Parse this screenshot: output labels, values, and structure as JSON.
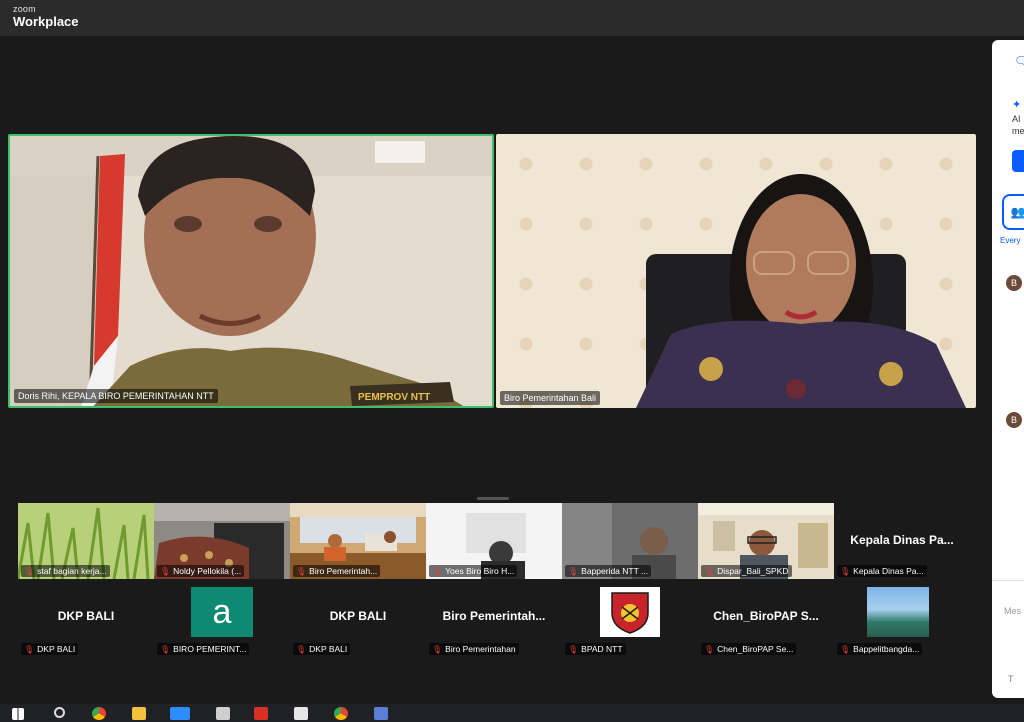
{
  "app": {
    "brand_small": "zoom",
    "brand_big": "Workplace"
  },
  "speakers": [
    {
      "name": "Doris Rihi, KEPALA BIRO PEMERINTAHAN NTT",
      "shirt_text": "PEMPROV NTT"
    },
    {
      "name": "Biro Pemerintahan Bali"
    }
  ],
  "thumbs_row1": [
    {
      "avatar_name": "",
      "tag": "staf bagian kerja..."
    },
    {
      "avatar_name": "",
      "tag": "Noldy Pellokila (..."
    },
    {
      "avatar_name": "",
      "tag": "Biro Pemerintah..."
    },
    {
      "avatar_name": "",
      "tag": "Yoes Biro Biro H..."
    },
    {
      "avatar_name": "",
      "tag": "Bapperida NTT ..."
    },
    {
      "avatar_name": "",
      "tag": "Dispar_Bali_SPKD"
    },
    {
      "avatar_name": "Kepala Dinas Pa...",
      "tag": "Kepala Dinas Pa..."
    }
  ],
  "thumbs_row2": [
    {
      "avatar_name": "DKP BALI",
      "tag": "DKP BALI"
    },
    {
      "avatar_letter": "a",
      "tag": "BIRO PEMERINT..."
    },
    {
      "avatar_name": "DKP BALI",
      "tag": "DKP BALI"
    },
    {
      "avatar_name": "Biro Pemerintah...",
      "tag": "Biro Pemerintahan"
    },
    {
      "avatar_name": "",
      "tag": "BPAD NTT"
    },
    {
      "avatar_name": "Chen_BiroPAP S...",
      "tag": "Chen_BiroPAP Se..."
    },
    {
      "avatar_name": "",
      "tag": "Bappelitbangda..."
    }
  ],
  "side_panel": {
    "ai_label": "AI",
    "ai_label2": "me",
    "everyone": "Every",
    "avatar_letter": "B",
    "msg_placeholder": "Mes",
    "format_icon": "T"
  },
  "icons": {
    "muted": "muted-mic-icon"
  },
  "colors": {
    "active_speaker_border": "#3ec06a",
    "muted_red": "#e0433c",
    "accent_blue": "#0b5cff"
  }
}
